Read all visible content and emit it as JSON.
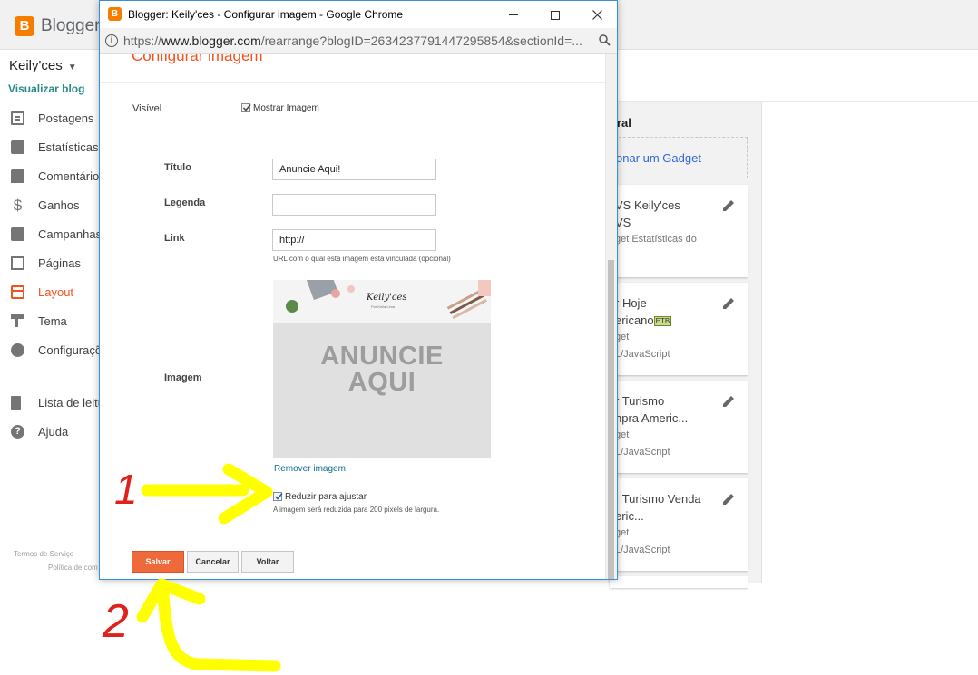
{
  "background": {
    "brand": "Blogger",
    "logo_letter": "B",
    "blog_name": "Keily'ces",
    "view_blog": "Visualizar blog",
    "nav": [
      {
        "label": "Postagens",
        "icon": "posts-icon"
      },
      {
        "label": "Estatísticas",
        "icon": "stats-icon"
      },
      {
        "label": "Comentários",
        "icon": "comments-icon"
      },
      {
        "label": "Ganhos",
        "icon": "earnings-icon"
      },
      {
        "label": "Campanhas",
        "icon": "campaigns-icon"
      },
      {
        "label": "Páginas",
        "icon": "pages-icon"
      },
      {
        "label": "Layout",
        "icon": "layout-icon",
        "active": true
      },
      {
        "label": "Tema",
        "icon": "theme-icon"
      },
      {
        "label": "Configurações",
        "icon": "settings-icon"
      }
    ],
    "nav_bottom": [
      {
        "label": "Lista de leitura",
        "icon": "reading-list-icon"
      },
      {
        "label": "Ajuda",
        "icon": "help-icon"
      }
    ],
    "footer": [
      "Termos de Serviço",
      "Política de com"
    ],
    "panel_title": "ral",
    "add_gadget": "onar um Gadget",
    "gadgets": [
      {
        "title": "VS Keily'ces",
        "title2": "VS",
        "sub": "get Estatísticas do",
        "sub2": ""
      },
      {
        "title": "r Hoje",
        "title2": "ericano",
        "badge": "ETB",
        "sub": "get",
        "sub2": "L/JavaScript"
      },
      {
        "title": "r Turismo",
        "title2": "npra Americ...",
        "sub": "get",
        "sub2": "L/JavaScript"
      },
      {
        "title": "r Turismo Venda",
        "title2": "eric...",
        "sub": "get",
        "sub2": "L/JavaScript"
      }
    ]
  },
  "window": {
    "favicon_letter": "B",
    "title": "Blogger: Keily'ces - Configurar imagem - Google Chrome",
    "url_prefix": "https://",
    "url_host": "www.blogger.com",
    "url_rest": "/rearrange?blogID=2634237791447295854&sectionId=..."
  },
  "form": {
    "heading": "Configurar imagem",
    "visible_label": "Visível",
    "show_image_label": "Mostrar Imagem",
    "show_image_checked": true,
    "title_label": "Título",
    "title_value": "Anuncie Aqui!",
    "caption_label": "Legenda",
    "caption_value": "",
    "link_label": "Link",
    "link_value": "http://",
    "link_hint": "URL com o qual esta imagem está vinculada (opcional)",
    "image_label": "Imagem",
    "image_logo": "Keily'ces",
    "image_logo_sub": "Por Keila Lima",
    "image_text_line1": "ANUNCIE",
    "image_text_line2": "AQUI",
    "remove_image": "Remover imagem",
    "shrink_label": "Reduzir para ajustar",
    "shrink_checked": true,
    "shrink_hint": "A imagem será reduzida para 200 pixels de largura.",
    "save_button": "Salvar",
    "cancel_button": "Cancelar",
    "back_button": "Voltar"
  },
  "annotations": {
    "label_1": "1",
    "label_2": "2",
    "arrow_color": "#ffff00",
    "number_color": "#e0201a"
  }
}
